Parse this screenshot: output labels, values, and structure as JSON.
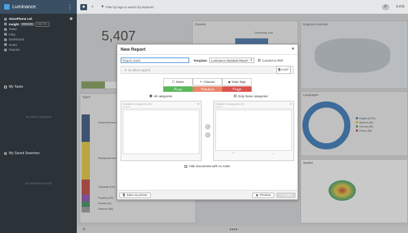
{
  "sidebar": {
    "brand": "Luminance",
    "project": "VoicePhone Ltd",
    "insight": "Insight",
    "pill_visualise": "VISUALISE",
    "pill_analyze": "ANALYZE",
    "items": [
      "Tasks",
      "Files",
      "Dashboard",
      "Notes",
      "Reports"
    ],
    "my_tasks": "My Tasks",
    "no_tasks": "No tasks assigned",
    "saved_searches": "My Saved Searches",
    "no_searches": "No searches saved"
  },
  "topbar": {
    "filter_placeholder": "Filter by tags or search by keyword",
    "doc_count": "5,41k"
  },
  "dashboard": {
    "big_number": "5,407",
    "clauses_title": "Clauses",
    "clause_label": "Governing Law",
    "regional_title": "Regional Activities",
    "types_title": "Types",
    "languages_title": "Languages",
    "spatial_title": "Spatial",
    "type_labels": [
      "Commercial and",
      "Employment and Re",
      "Corporate (130)",
      "Property (132)",
      "Finance (24)",
      "Unknown (88)"
    ],
    "language_legend": [
      "English (5,076)",
      "Spanish (39)",
      "German (55)",
      "French (58)"
    ],
    "language_colors": [
      "#2a6fb5",
      "#e6b800",
      "#3b9b5a",
      "#c0392b"
    ]
  },
  "modal": {
    "title": "New Report",
    "report_name_placeholder": "Report name",
    "template_label": "Template:",
    "template_value": "Luminance Standard Report",
    "convert_pdf": "Convert to PDF",
    "no_filters": "No filters applied",
    "filter_count": "5,407",
    "tabs": [
      "Notes",
      "Clauses",
      "Data Tags"
    ],
    "severity": [
      {
        "label": "Low",
        "color": "#5cb85c"
      },
      {
        "label": "Medium",
        "color": "#e8876b"
      },
      {
        "label": "High",
        "color": "#d9534f"
      }
    ],
    "all_categories": "All categories",
    "only_categories": "Only these categories:",
    "disabled_left": "Disabled Categories (0)",
    "disabled_right": "Disabled Categories (0)",
    "search_placeholder": "Search",
    "hide_docs": "Hide documents with no notes",
    "save_preset": "Save as preset",
    "preview": "Preview",
    "create": "Create"
  }
}
